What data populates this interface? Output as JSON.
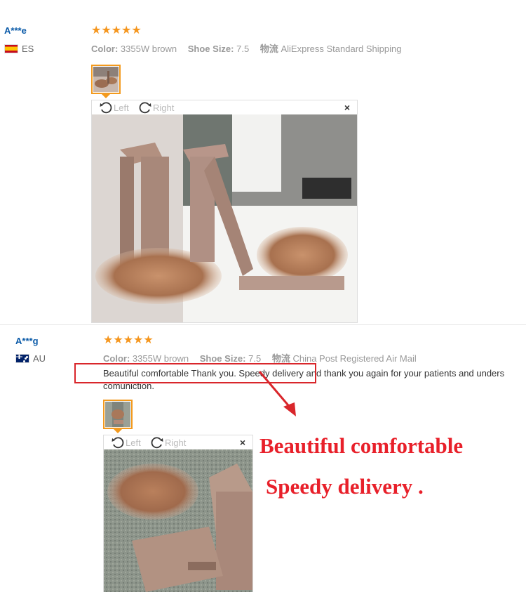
{
  "reviews": [
    {
      "user": "A***e",
      "country": "ES",
      "stars": "★★★★★",
      "color_label": "Color:",
      "color_value": "3355W brown",
      "size_label": "Shoe Size:",
      "size_value": "7.5",
      "shipping_label": "物流",
      "shipping_value": "AliExpress Standard Shipping",
      "rotate_left": "Left",
      "rotate_right": "Right",
      "close": "×"
    },
    {
      "user": "A***g",
      "country": "AU",
      "stars": "★★★★★",
      "color_label": "Color:",
      "color_value": "3355W brown",
      "size_label": "Shoe Size:",
      "size_value": "7.5",
      "shipping_label": "物流",
      "shipping_value": "China Post Registered Air Mail",
      "text_line1": "Beautiful comfortable Thank you. Speedy delivery and thank you again for your patients and unders",
      "text_line2": "comuniction.",
      "rotate_left": "Left",
      "rotate_right": "Right",
      "close": "×"
    }
  ],
  "callout": {
    "line1": "Beautiful comfortable",
    "line2": "Speedy delivery ."
  },
  "colors": {
    "star": "#f5961e",
    "link": "#0a5aa8",
    "highlight": "#d9262b",
    "callout": "#e8202a",
    "thumb_border": "#f39a1e"
  },
  "icons": [
    "rotate-left-icon",
    "rotate-right-icon",
    "close-icon",
    "star-icon",
    "flag-icon"
  ]
}
